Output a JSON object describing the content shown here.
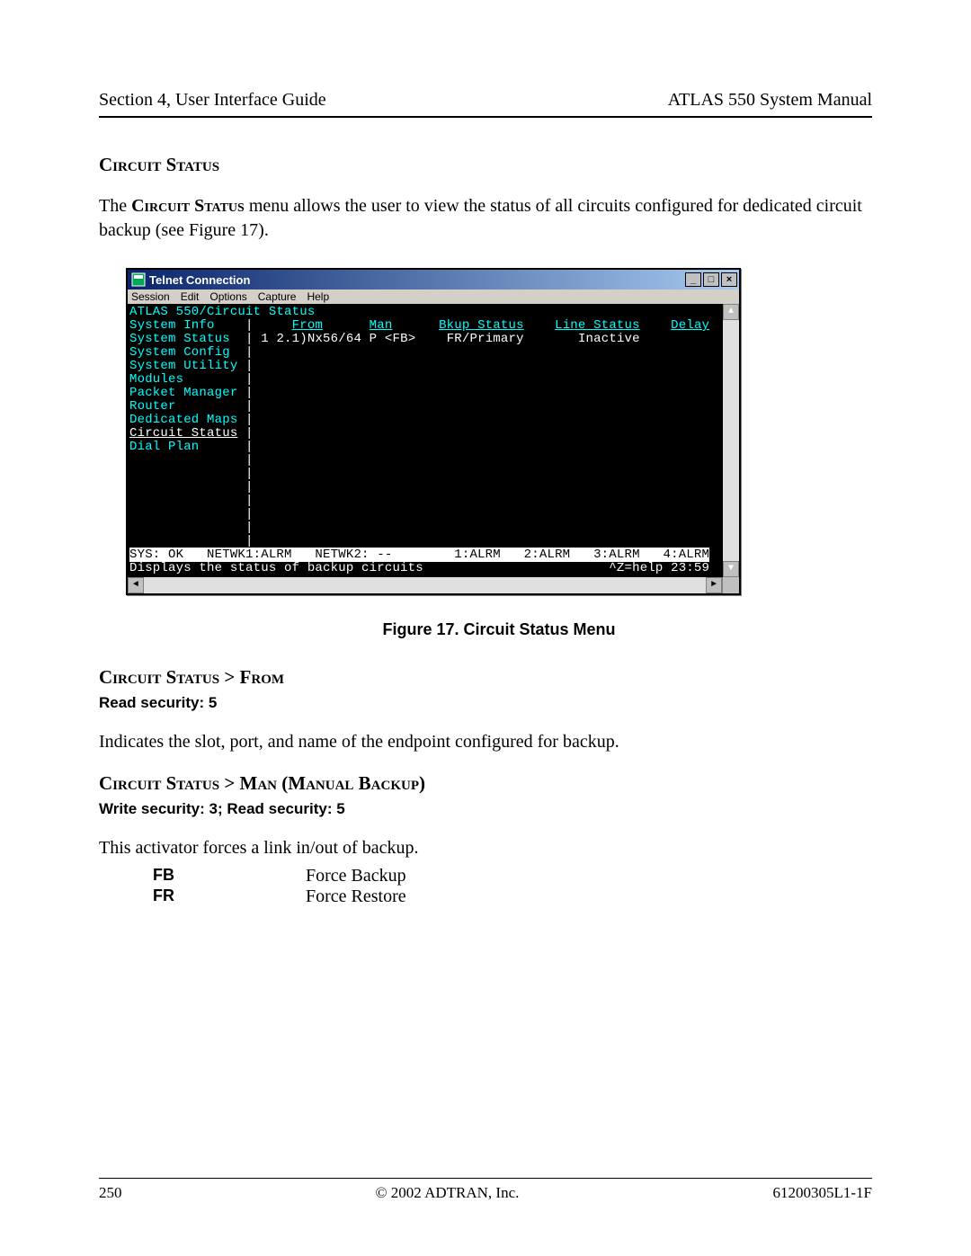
{
  "header": {
    "left": "Section 4, User Interface Guide",
    "right": "ATLAS 550 System Manual"
  },
  "section1": {
    "heading": "Circuit Status",
    "para_pre": "The ",
    "para_bold": "Circuit Status",
    "para_post": " menu allows the user to view the status of all circuits configured for dedicated circuit backup (see Figure 17)."
  },
  "fig": {
    "caption": "Figure 17.  Circuit Status Menu"
  },
  "telnet": {
    "title": "Telnet Connection",
    "menu": [
      "Session",
      "Edit",
      "Options",
      "Capture",
      "Help"
    ],
    "breadcrumb": "ATLAS 550/Circuit Status",
    "sidebar": [
      "System Info",
      "System Status",
      "System Config",
      "System Utility",
      "Modules",
      "Packet Manager",
      "Router",
      "Dedicated Maps",
      "Circuit Status",
      "Dial Plan"
    ],
    "columns": {
      "from": "From",
      "man": "Man",
      "bkup": "Bkup Status",
      "line": "Line Status",
      "delay": "Delay"
    },
    "row": {
      "idx": "1",
      "from": "2.1)Nx56/64 P",
      "man": "<FB>",
      "bkup": "FR/Primary",
      "line": "Inactive",
      "delay": ""
    },
    "status1": "SYS: OK   NETWK1:ALRM   NETWK2: --        1:ALRM   2:ALRM   3:ALRM   4:ALRM",
    "status2_left": "Displays the status of backup circuits",
    "status2_right": "^Z=help 23:59"
  },
  "section2": {
    "heading": "Circuit Status > From",
    "security": "Read security: 5",
    "body": "Indicates the slot, port, and name of the endpoint configured for backup."
  },
  "section3": {
    "heading": "Circuit Status > Man (Manual Backup)",
    "security": "Write security: 3; Read security: 5",
    "body": "This activator forces a link in/out of backup.",
    "defs": [
      {
        "term": "FB",
        "def": "Force Backup"
      },
      {
        "term": "FR",
        "def": "Force Restore"
      }
    ]
  },
  "footer": {
    "left": "250",
    "center": "© 2002 ADTRAN, Inc.",
    "right": "61200305L1-1F"
  }
}
